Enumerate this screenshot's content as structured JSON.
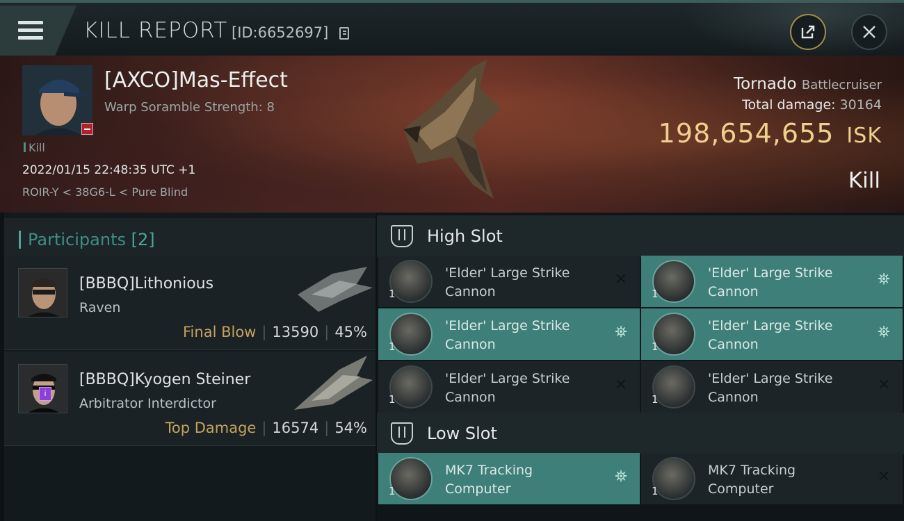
{
  "header": {
    "title": "KILL REPORT",
    "report_id": "[ID:6652697]"
  },
  "victim": {
    "name": "[AXCO]Mas-Effect",
    "subtitle": "Warp Soramble Strength: 8",
    "kill_label": "Kill",
    "timestamp": "2022/01/15 22:48:35 UTC +1",
    "location": "ROIR-Y < 38G6-L < Pure Blind",
    "ship_name": "Tornado",
    "ship_class": "Battlecruiser",
    "total_damage_label": "Total damage:",
    "total_damage": "30164",
    "isk_value": "198,654,655",
    "isk_unit": "ISK",
    "result": "Kill"
  },
  "participants": {
    "title": "Participants",
    "count": "[2]",
    "list": [
      {
        "name": "[BBBQ]Lithonious",
        "ship": "Raven",
        "tag": "Final Blow",
        "damage": "13590",
        "percent": "45%"
      },
      {
        "name": "[BBBQ]Kyogen Steiner",
        "ship": "Arbitrator Interdictor",
        "tag": "Top Damage",
        "damage": "16574",
        "percent": "54%",
        "badge": "i"
      }
    ]
  },
  "fitting": {
    "high_slot": {
      "title": "High Slot",
      "modules": [
        {
          "line1": "'Elder' Large Strike",
          "line2": "Cannon",
          "qty": "1",
          "state": "destroyed",
          "flag": "✕"
        },
        {
          "line1": "'Elder' Large Strike",
          "line2": "Cannon",
          "qty": "1",
          "state": "dropped",
          "flag": "⛯"
        },
        {
          "line1": "'Elder' Large Strike",
          "line2": "Cannon",
          "qty": "1",
          "state": "dropped",
          "flag": "⛯"
        },
        {
          "line1": "'Elder' Large Strike",
          "line2": "Cannon",
          "qty": "1",
          "state": "dropped",
          "flag": "⛯"
        },
        {
          "line1": "'Elder' Large Strike",
          "line2": "Cannon",
          "qty": "1",
          "state": "destroyed",
          "flag": "✕"
        },
        {
          "line1": "'Elder' Large Strike",
          "line2": "Cannon",
          "qty": "1",
          "state": "destroyed",
          "flag": "✕"
        }
      ]
    },
    "low_slot": {
      "title": "Low Slot",
      "modules": [
        {
          "line1": "MK7 Tracking",
          "line2": "Computer",
          "qty": "1",
          "state": "dropped",
          "flag": "⛯"
        },
        {
          "line1": "MK7 Tracking",
          "line2": "Computer",
          "qty": "1",
          "state": "destroyed",
          "flag": "✕"
        }
      ]
    }
  },
  "colors": {
    "accent_teal": "#3f7f79",
    "isk_gold": "#f0d08e",
    "tag_gold": "#c5a25d",
    "destroyed_flag": "#0f1517"
  }
}
